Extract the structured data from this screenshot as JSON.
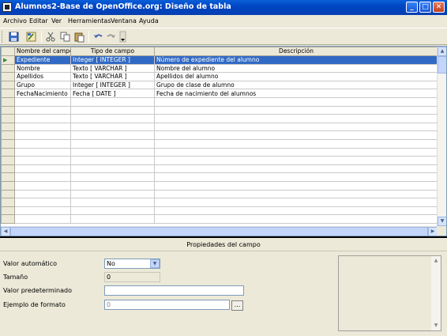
{
  "window": {
    "title": "Alumnos2-Base de OpenOffice.org: Diseño de tabla",
    "min_label": "_",
    "max_label": "□",
    "close_label": "✕"
  },
  "menu": [
    {
      "label": "Archivo"
    },
    {
      "label": "Editar"
    },
    {
      "label": "Ver"
    },
    {
      "label": "Herramientas"
    },
    {
      "label": "Ventana"
    },
    {
      "label": "Ayuda"
    }
  ],
  "toolbar": {
    "icons": [
      "save-icon",
      "design-icon",
      "cut-icon",
      "copy-icon",
      "paste-icon",
      "undo-icon",
      "redo-icon",
      "more-icon"
    ]
  },
  "grid": {
    "columns": [
      "Nombre del campo",
      "Tipo de campo",
      "Descripción"
    ],
    "rows": [
      {
        "name": "Expediente",
        "type": "Integer [ INTEGER ]",
        "desc": "Número de expediente del alumno"
      },
      {
        "name": "Nombre",
        "type": "Texto [ VARCHAR ]",
        "desc": "Nombre del alumno"
      },
      {
        "name": "Apellidos",
        "type": "Texto [ VARCHAR ]",
        "desc": "Apellidos del alumno"
      },
      {
        "name": "Grupo",
        "type": "Integer [ INTEGER ]",
        "desc": "Grupo de clase de alumno"
      },
      {
        "name": "FechaNacimiento",
        "type": "Fecha [ DATE ]",
        "desc": "Fecha de nacimiento del alumnos"
      }
    ],
    "selected_row": 0,
    "empty_rows": 15
  },
  "properties": {
    "header": "Propiedades del campo",
    "auto_value_label": "Valor automático",
    "auto_value": "No",
    "size_label": "Tamaño",
    "size_value": "0",
    "default_label": "Valor predeterminado",
    "default_value": "",
    "format_label": "Ejemplo de formato",
    "format_value": "0",
    "format_button": "..."
  }
}
